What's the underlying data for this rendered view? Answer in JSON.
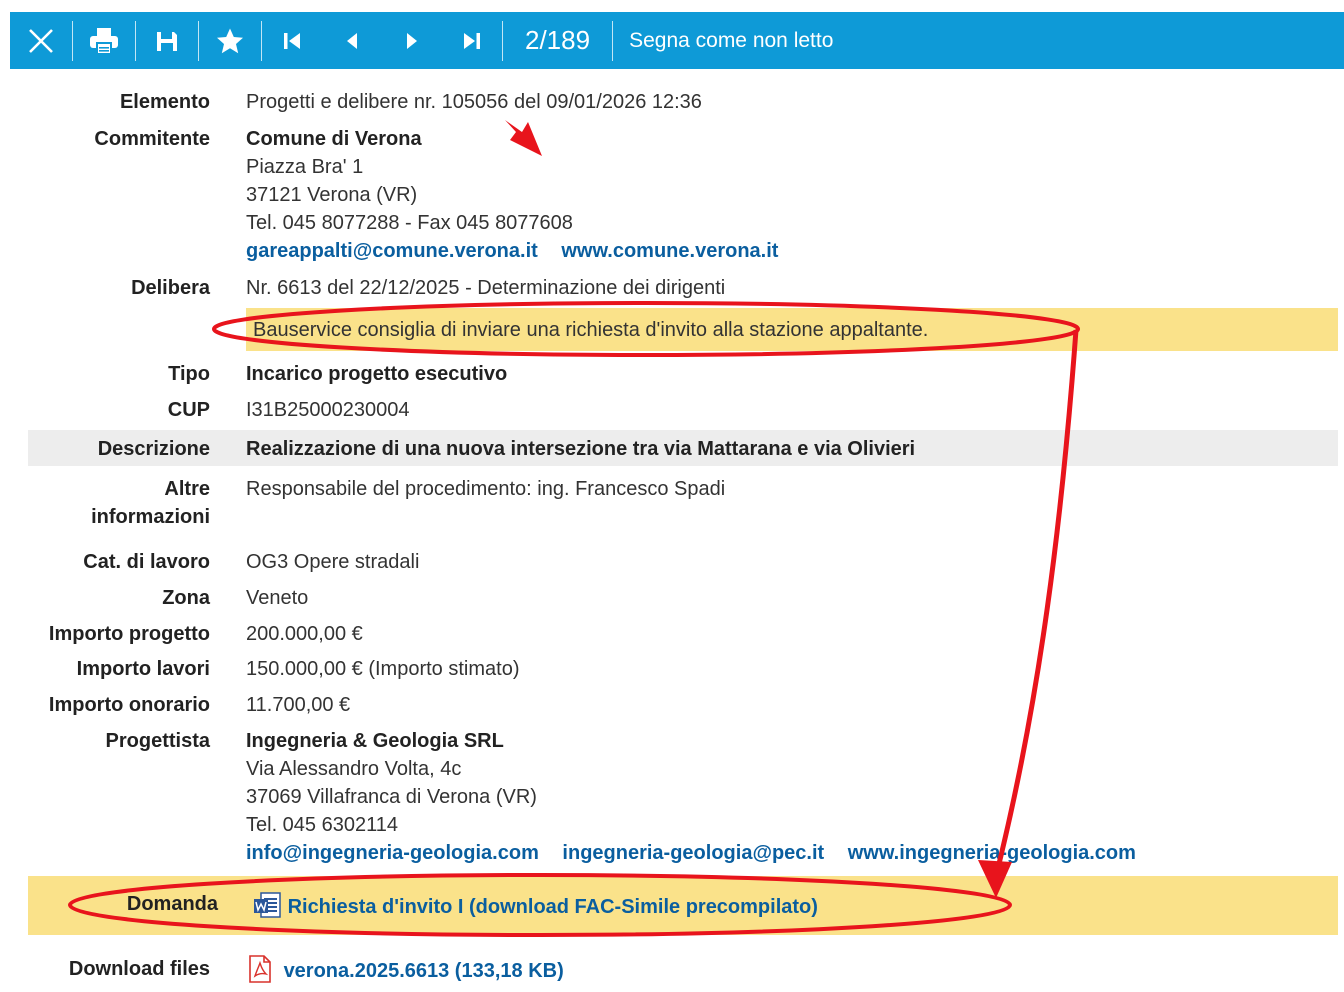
{
  "toolbar": {
    "counter": "2/189",
    "mark_unread": "Segna come non letto"
  },
  "details": {
    "elemento": {
      "label": "Elemento",
      "value": "Progetti e delibere nr. 105056 del 09/01/2026 12:36"
    },
    "committente": {
      "label": "Commitente",
      "name": "Comune di Verona",
      "address": "Piazza Bra' 1",
      "city": "37121 Verona (VR)",
      "phone": "Tel. 045 8077288 - Fax 045 8077608",
      "email": "gareappalti@comune.verona.it",
      "web": "www.comune.verona.it"
    },
    "delibera": {
      "label": "Delibera",
      "value": "Nr. 6613 del 22/12/2025 - Determinazione dei dirigenti"
    },
    "advice": "Bauservice consiglia di inviare una richiesta d'invito alla stazione appaltante.",
    "tipo": {
      "label": "Tipo",
      "value": "Incarico progetto esecutivo"
    },
    "cup": {
      "label": "CUP",
      "value": "I31B25000230004"
    },
    "descrizione": {
      "label": "Descrizione",
      "value": "Realizzazione di una nuova intersezione tra via Mattarana e via Olivieri"
    },
    "altre": {
      "label_line1": "Altre",
      "label_line2": "informazioni",
      "value": "Responsabile del procedimento: ing. Francesco Spadi"
    },
    "categoria": {
      "label": "Cat. di lavoro",
      "value": "OG3 Opere stradali"
    },
    "zona": {
      "label": "Zona",
      "value": "Veneto"
    },
    "importo_progetto": {
      "label": "Importo progetto",
      "value": "200.000,00 €"
    },
    "importo_lavori": {
      "label": "Importo lavori",
      "value": "150.000,00 € (Importo stimato)"
    },
    "importo_onorario": {
      "label": "Importo onorario",
      "value": "11.700,00 €"
    },
    "progettista": {
      "label": "Progettista",
      "name": "Ingegneria & Geologia SRL",
      "address": "Via Alessandro Volta, 4c",
      "city": "37069 Villafranca di Verona (VR)",
      "phone": "Tel. 045 6302114",
      "email": "info@ingegneria-geologia.com",
      "pec": "ingegneria-geologia@pec.it",
      "web": "www.ingegneria-geologia.com"
    },
    "domanda": {
      "label": "Domanda",
      "link": "Richiesta d'invito I (download FAC-Simile precompilato)"
    },
    "download": {
      "label": "Download files",
      "file": "verona.2025.6613 (133,18 KB)"
    }
  },
  "colors": {
    "toolbar_bg": "#0e9ad7",
    "link": "#0a5e9f",
    "highlight": "#fae28a",
    "annotation": "#e8141c"
  }
}
